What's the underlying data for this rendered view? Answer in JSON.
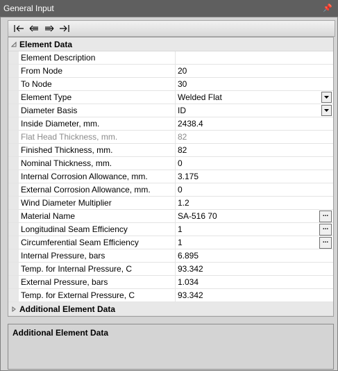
{
  "window": {
    "title": "General Input",
    "pin_glyph": "Ł"
  },
  "toolbar": {
    "buttons": [
      {
        "name": "first-record-button",
        "icon": "first-arrow-icon"
      },
      {
        "name": "previous-record-button",
        "icon": "left-arrow-icon"
      },
      {
        "name": "next-record-button",
        "icon": "right-arrow-icon"
      },
      {
        "name": "last-record-button",
        "icon": "last-arrow-icon"
      }
    ]
  },
  "grid": {
    "category_element_data": "Element Data",
    "category_additional": "Additional Element Data",
    "rows": [
      {
        "label": "Element Description",
        "value": ""
      },
      {
        "label": "From Node",
        "value": "20"
      },
      {
        "label": "To Node",
        "value": "30"
      },
      {
        "label": "Element Type",
        "value": "Welded Flat",
        "control": "dropdown"
      },
      {
        "label": "Diameter Basis",
        "value": "ID",
        "control": "dropdown"
      },
      {
        "label": "Inside Diameter, mm.",
        "value": "2438.4"
      },
      {
        "label": "Flat Head Thickness, mm.",
        "value": "82",
        "disabled": true
      },
      {
        "label": "Finished Thickness, mm.",
        "value": "82"
      },
      {
        "label": "Nominal Thickness, mm.",
        "value": "0"
      },
      {
        "label": "Internal Corrosion Allowance, mm.",
        "value": "3.175"
      },
      {
        "label": "External Corrosion Allowance, mm.",
        "value": "0"
      },
      {
        "label": "Wind Diameter Multiplier",
        "value": "1.2"
      },
      {
        "label": "Material Name",
        "value": "SA-516 70",
        "control": "ellipsis"
      },
      {
        "label": "Longitudinal Seam Efficiency",
        "value": "1",
        "control": "ellipsis"
      },
      {
        "label": "Circumferential Seam Efficiency",
        "value": "1",
        "control": "ellipsis"
      },
      {
        "label": "Internal Pressure, bars",
        "value": "6.895"
      },
      {
        "label": "Temp. for Internal Pressure, C",
        "value": "93.342"
      },
      {
        "label": "External Pressure, bars",
        "value": "1.034"
      },
      {
        "label": "Temp. for External Pressure, C",
        "value": "93.342"
      }
    ],
    "ellipsis_text": "..."
  },
  "description": {
    "title": "Additional Element Data"
  }
}
